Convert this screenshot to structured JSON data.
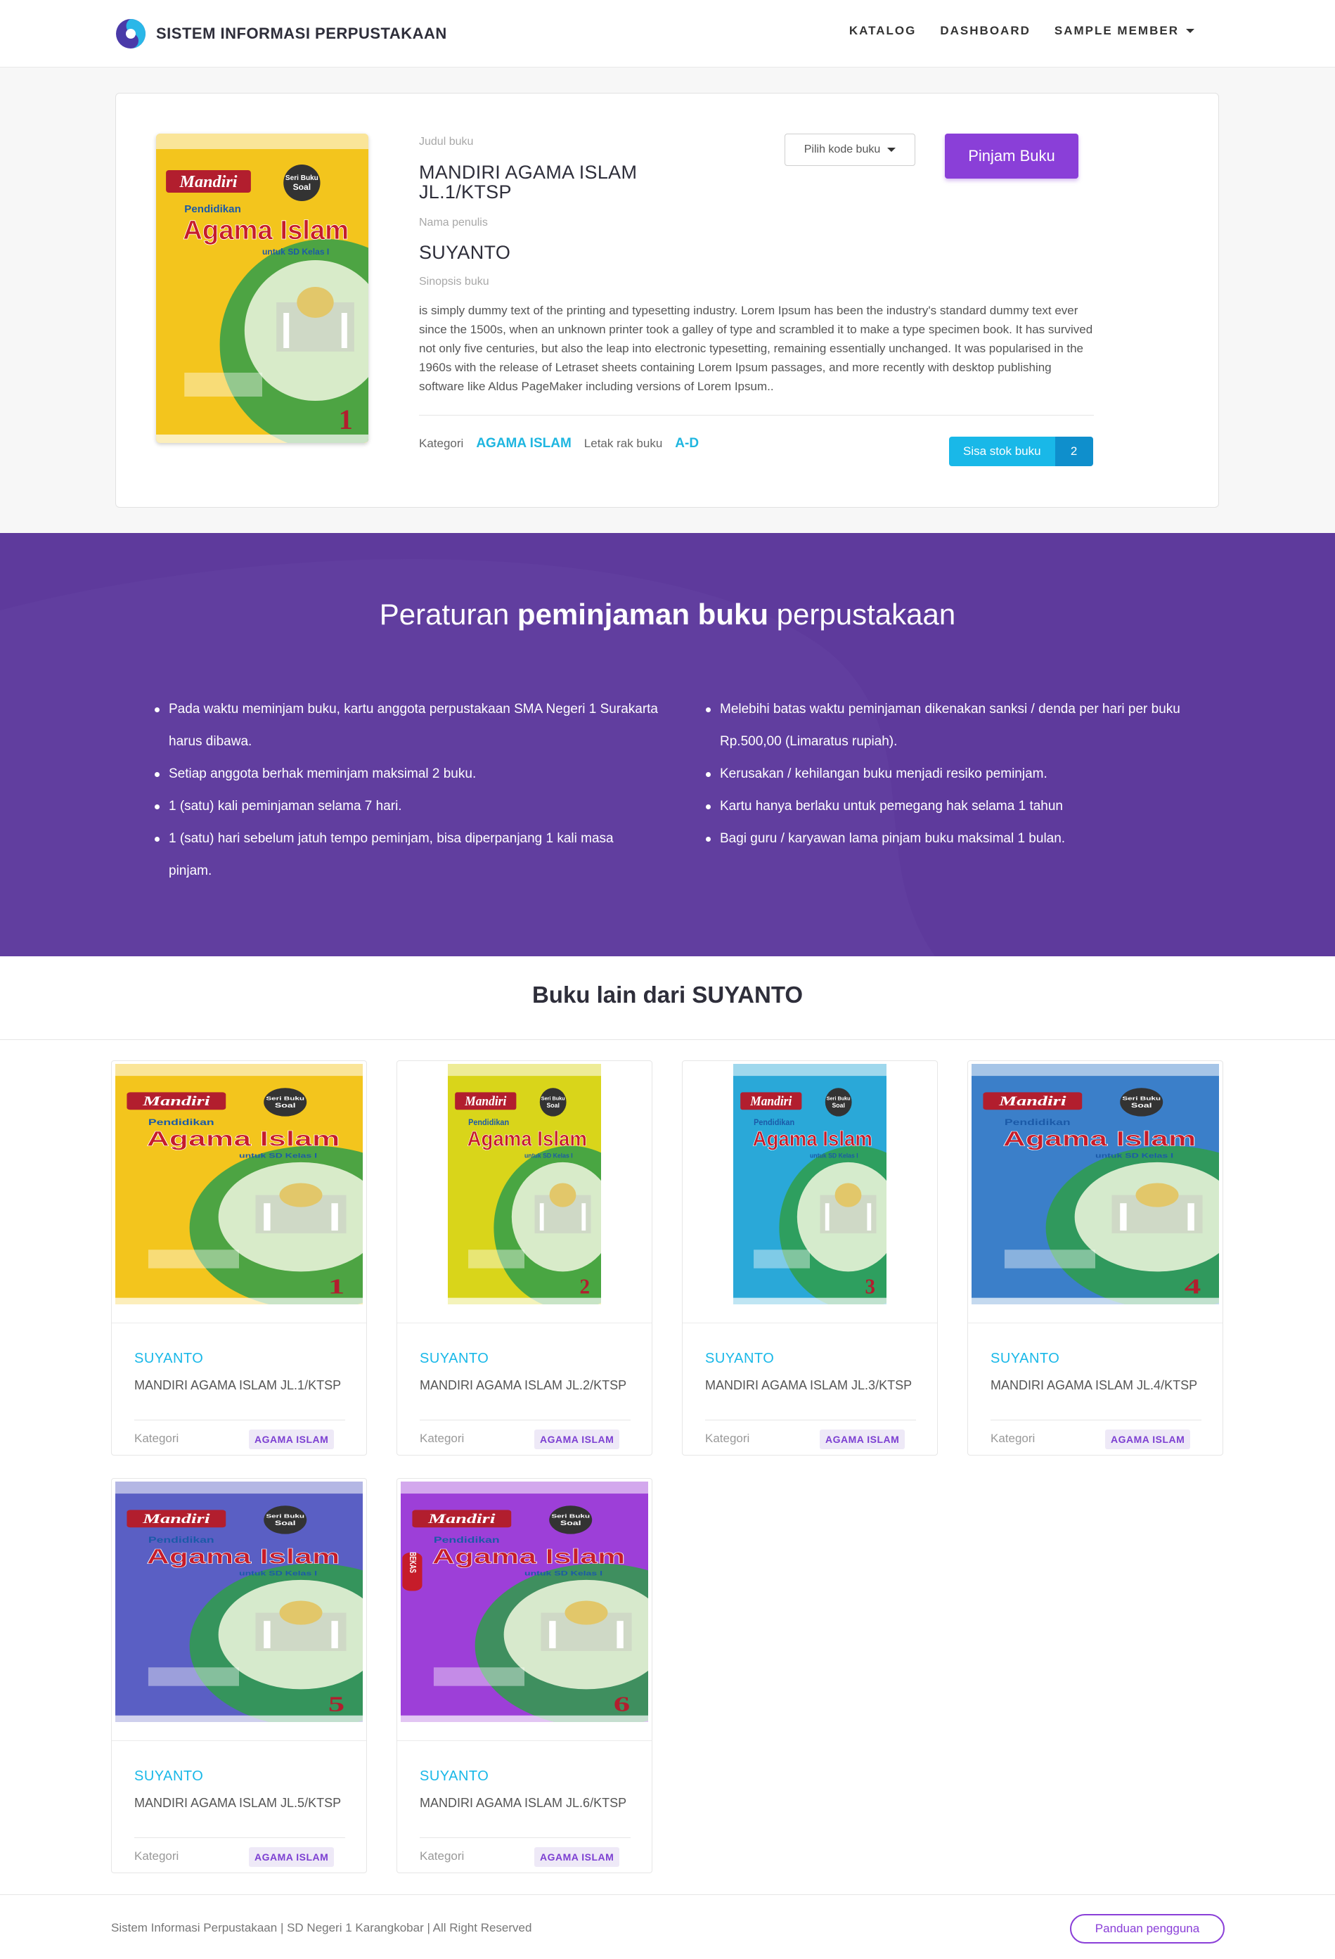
{
  "brand": {
    "name": "SISTEM INFORMASI PERPUSTAKAAN"
  },
  "nav": {
    "items": [
      "KATALOG",
      "DASHBOARD",
      "SAMPLE MEMBER"
    ]
  },
  "book": {
    "title_label": "Judul buku",
    "title": "MANDIRI AGAMA ISLAM JL.1/KTSP",
    "author_label": "Nama penulis",
    "author": "SUYANTO",
    "synopsis_label": "Sinopsis buku",
    "synopsis": "is simply dummy text of the printing and typesetting industry. Lorem Ipsum has been the industry's standard dummy text ever since the 1500s, when an unknown printer took a galley of type and scrambled it to make a type specimen book. It has survived not only five centuries, but also the leap into electronic typesetting, remaining essentially unchanged. It was popularised in the 1960s with the release of Letraset sheets containing Lorem Ipsum passages, and more recently with desktop publishing software like Aldus PageMaker including versions of Lorem Ipsum..",
    "category_label": "Kategori",
    "category": "AGAMA ISLAM",
    "shelf_label": "Letak rak buku",
    "shelf": "A-D",
    "stock_label": "Sisa stok buku",
    "stock": "2",
    "select_label": "Pilih kode buku",
    "borrow_label": "Pinjam Buku"
  },
  "rules": {
    "title_pre": "Peraturan",
    "title_bold": "peminjaman buku",
    "title_post": "perpustakaan",
    "left": [
      "Pada waktu meminjam buku, kartu anggota perpustakaan SMA Negeri 1 Surakarta harus dibawa.",
      "Setiap anggota berhak meminjam maksimal 2 buku.",
      "1 (satu) kali peminjaman selama 7 hari.",
      "1 (satu) hari sebelum jatuh tempo peminjam, bisa diperpanjang 1 kali masa pinjam."
    ],
    "right": [
      "Melebihi batas waktu peminjaman dikenakan sanksi / denda per hari per buku Rp.500,00 (Limaratus rupiah).",
      "Kerusakan / kehilangan buku menjadi resiko peminjam.",
      "Kartu hanya berlaku untuk pemegang hak selama 1 tahun",
      "Bagi guru / karyawan lama pinjam buku maksimal 1 bulan."
    ]
  },
  "other": {
    "title": "Buku lain dari SUYANTO",
    "books": [
      {
        "author": "SUYANTO",
        "title": "MANDIRI AGAMA ISLAM JL.1/KTSP",
        "kat_label": "Kategori",
        "category": "AGAMA ISLAM",
        "cover_num": "1",
        "cover_color": "#f3c51d"
      },
      {
        "author": "SUYANTO",
        "title": "MANDIRI AGAMA ISLAM JL.2/KTSP",
        "kat_label": "Kategori",
        "category": "AGAMA ISLAM",
        "cover_num": "2",
        "cover_color": "#d9d51a"
      },
      {
        "author": "SUYANTO",
        "title": "MANDIRI AGAMA ISLAM JL.3/KTSP",
        "kat_label": "Kategori",
        "category": "AGAMA ISLAM",
        "cover_num": "3",
        "cover_color": "#2aa8d8"
      },
      {
        "author": "SUYANTO",
        "title": "MANDIRI AGAMA ISLAM JL.4/KTSP",
        "kat_label": "Kategori",
        "category": "AGAMA ISLAM",
        "cover_num": "4",
        "cover_color": "#3b7fc9"
      },
      {
        "author": "SUYANTO",
        "title": "MANDIRI AGAMA ISLAM JL.5/KTSP",
        "kat_label": "Kategori",
        "category": "AGAMA ISLAM",
        "cover_num": "5",
        "cover_color": "#5a5fc4"
      },
      {
        "author": "SUYANTO",
        "title": "MANDIRI AGAMA ISLAM JL.6/KTSP",
        "kat_label": "Kategori",
        "category": "AGAMA ISLAM",
        "cover_num": "6",
        "cover_color": "#9d3fd8"
      }
    ]
  },
  "cover_text": {
    "series": "Mandiri",
    "badge": "Seri Buku Soal",
    "sub": "Pendidikan",
    "main": "Agama Islam",
    "grade": "untuk SD Kelas I",
    "stamp": "BEKAS"
  },
  "footer": {
    "text": "Sistem Informasi Perpustakaan | SD Negeri 1 Karangkobar | All Right Reserved",
    "guide": "Panduan pengguna"
  },
  "colors": {
    "accent": "#8a3fd8",
    "rules_bg": "#5e3a9c",
    "link": "#19b8e8"
  }
}
